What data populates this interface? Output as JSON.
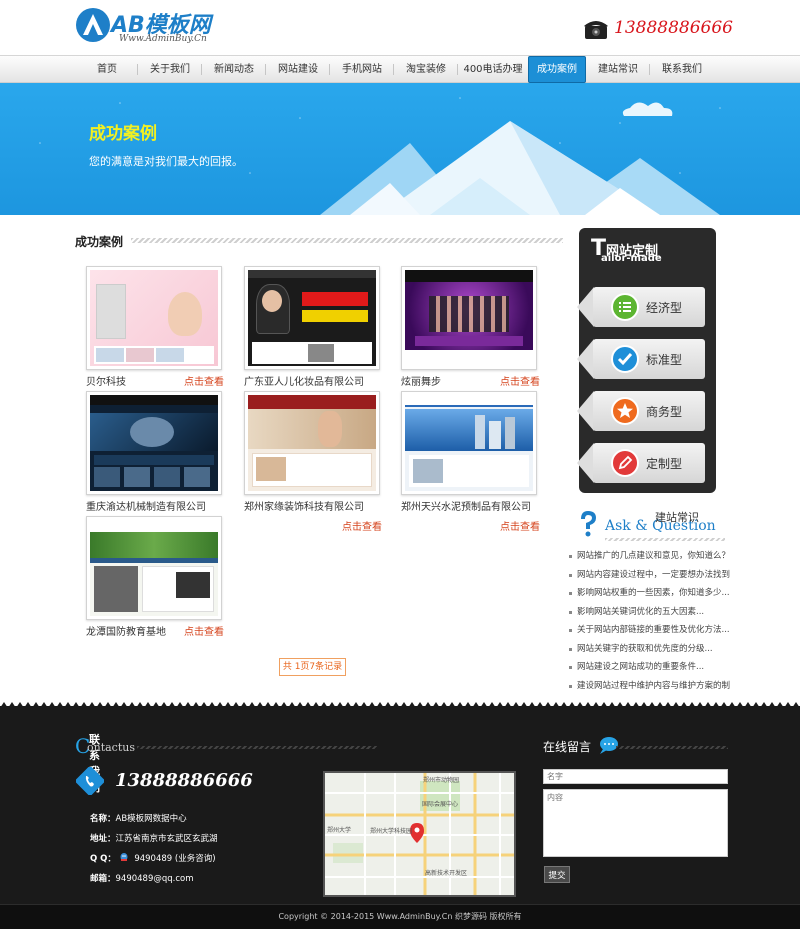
{
  "header": {
    "logo_text": "AB模板网",
    "logo_sub": "Www.AdminBuy.Cn",
    "phone": "13888886666"
  },
  "nav": {
    "items": [
      {
        "label": "首页"
      },
      {
        "label": "关于我们"
      },
      {
        "label": "新闻动态"
      },
      {
        "label": "网站建设"
      },
      {
        "label": "手机网站"
      },
      {
        "label": "淘宝装修"
      },
      {
        "label": "400电话办理"
      },
      {
        "label": "成功案例",
        "active": true
      },
      {
        "label": "建站常识"
      },
      {
        "label": "联系我们"
      }
    ]
  },
  "banner": {
    "title": "成功案例",
    "subtitle": "您的满意是对我们最大的回报。"
  },
  "section": {
    "title": "成功案例"
  },
  "cases": [
    {
      "name": "贝尔科技",
      "more": "点击查看"
    },
    {
      "name": "广东亚人儿化妆品有限公司",
      "more": ""
    },
    {
      "name": "炫丽舞步",
      "more": "点击查看"
    },
    {
      "name": "重庆渝达机械制造有限公司",
      "more": ""
    },
    {
      "name": "郑州家缘装饰科技有限公司",
      "more": "点击查看"
    },
    {
      "name": "郑州天兴水泥预制品有限公司",
      "more": "点击查看"
    },
    {
      "name": "龙潭国防教育基地",
      "more": "点击查看"
    }
  ],
  "pager": "共 1页7条记录",
  "tailor": {
    "title_cn": "网站定制",
    "title_en_big": "T",
    "title_en": "ailor-made",
    "items": [
      {
        "label": "经济型",
        "icon": "list-icon",
        "color": "#5cb531"
      },
      {
        "label": "标准型",
        "icon": "check-icon",
        "color": "#1e8fd8"
      },
      {
        "label": "商务型",
        "icon": "star-icon",
        "color": "#ef6a1e"
      },
      {
        "label": "定制型",
        "icon": "pencil-icon",
        "color": "#e23a3a"
      }
    ]
  },
  "ask": {
    "title_cn": "建站常识",
    "title_en": "Ask & Question"
  },
  "news": [
    "网站推广的几点建议和意见，你知道么？...",
    "网站内容建设过程中，一定要想办法找到能...",
    "影响网站权重的一些因素，你知道多少...",
    "影响网站关键词优化的五大因素...",
    "关于网站内部链接的重要性及优化方法...",
    "网站关键字的获取和优先度的分级...",
    "网站建设之网站成功的重要条件...",
    "建设网站过程中维护内容与维护方案的制..."
  ],
  "footer": {
    "contact_title": "联系我们",
    "contact_en": "ontactus",
    "contact_en_big": "C",
    "phone": "13888886666",
    "name_label": "名称：",
    "name_value": "AB模板网数据中心",
    "address_label": "地址：",
    "address_value": "江苏省南京市玄武区玄武湖",
    "qq_label": "Q Q：",
    "qq_value": "9490489 (业务咨询)",
    "email_label": "邮箱：",
    "email_value": "9490489@qq.com",
    "message_title": "在线留言",
    "name_placeholder": "名字",
    "content_placeholder": "内容",
    "submit_label": "提交",
    "copyright": "Copyright © 2014-2015 Www.AdminBuy.Cn 织梦源码 版权所有"
  },
  "map": {
    "labels": [
      "郑州市动物园",
      "国际会展中心",
      "郑州大学",
      "郑州大学科技园",
      "高新技术开发区"
    ]
  }
}
